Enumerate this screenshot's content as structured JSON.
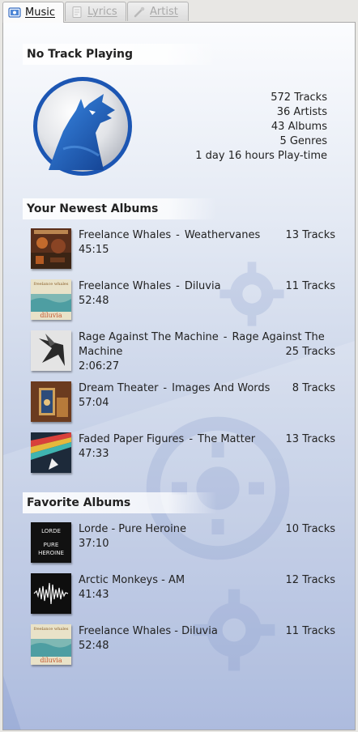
{
  "tabs": [
    {
      "label": "Music",
      "icon": "music-tab-icon",
      "active": true
    },
    {
      "label": "Lyrics",
      "icon": "lyrics-icon",
      "active": false
    },
    {
      "label": "Artist",
      "icon": "artist-icon",
      "active": false
    }
  ],
  "now_playing": {
    "title": "No Track Playing"
  },
  "stats": {
    "tracks": "572 Tracks",
    "artists": "36 Artists",
    "albums": "43 Albums",
    "genres": "5 Genres",
    "playtime": "1 day 16 hours Play-time"
  },
  "newest": {
    "title": "Your Newest Albums",
    "items": [
      {
        "artist": "Freelance Whales",
        "album": "Weathervanes",
        "tracks": "13 Tracks",
        "duration": "45:15"
      },
      {
        "artist": "Freelance Whales",
        "album": "Diluvia",
        "tracks": "11 Tracks",
        "duration": "52:48"
      },
      {
        "artist": "Rage Against The Machine",
        "album": "Rage Against The Machine",
        "tracks": "25 Tracks",
        "duration": "2:06:27"
      },
      {
        "artist": "Dream Theater",
        "album": "Images And Words",
        "tracks": "8 Tracks",
        "duration": "57:04"
      },
      {
        "artist": "Faded Paper Figures",
        "album": "The Matter",
        "tracks": "13 Tracks",
        "duration": "47:33"
      }
    ]
  },
  "favorites": {
    "title": "Favorite Albums",
    "items": [
      {
        "name": "Lorde - Pure Heroine",
        "tracks": "10 Tracks",
        "duration": "37:10"
      },
      {
        "name": "Arctic Monkeys - AM",
        "tracks": "12 Tracks",
        "duration": "41:43"
      },
      {
        "name": "Freelance Whales - Diluvia",
        "tracks": "11 Tracks",
        "duration": "52:48"
      }
    ]
  },
  "covers": {
    "diluvia_band": "freelance whales",
    "diluvia_title": "diluvia",
    "lorde_top": "LORDE",
    "lorde_mid": "PURE",
    "lorde_bot": "HEROINE"
  },
  "colors": {
    "accent": "#1f5fb8",
    "panel_top": "#fbfcfe",
    "panel_bottom": "#9eafd8"
  }
}
